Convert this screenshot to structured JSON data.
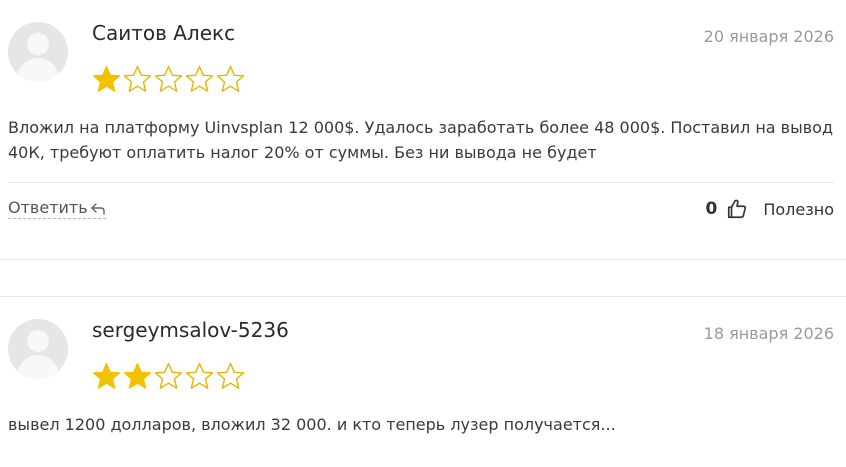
{
  "colors": {
    "star_filled": "#f2c200",
    "star_empty_outline": "#e2b600"
  },
  "reviews": [
    {
      "author": "Саитов Алекс",
      "date": "20 января 2026",
      "rating": 1,
      "max_rating": 5,
      "text": "Вложил на платформу Uinvsplan 12 000$. Удалось заработать более 48 000$. Поставил на вывод 40К, требуют оплатить налог 20% от суммы. Без ни вывода не будет",
      "reply_label": "Ответить",
      "helpful_count": "0",
      "helpful_label": "Полезно"
    },
    {
      "author": "sergeymsalov-5236",
      "date": "18 января 2026",
      "rating": 2,
      "max_rating": 5,
      "text": "вывел 1200 долларов, вложил 32 000. и кто теперь лузер получается..."
    }
  ]
}
